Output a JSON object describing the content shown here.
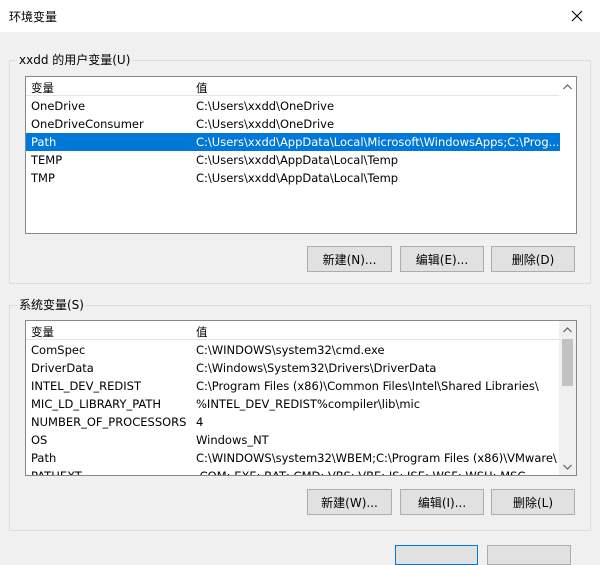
{
  "window": {
    "title": "环境变量"
  },
  "user_vars": {
    "label": "xxdd 的用户变量(U)",
    "columns": [
      "变量",
      "值"
    ],
    "rows": [
      {
        "name": "OneDrive",
        "value": "C:\\Users\\xxdd\\OneDrive"
      },
      {
        "name": "OneDriveConsumer",
        "value": "C:\\Users\\xxdd\\OneDrive"
      },
      {
        "name": "Path",
        "value": "C:\\Users\\xxdd\\AppData\\Local\\Microsoft\\WindowsApps;C:\\Prog..."
      },
      {
        "name": "TEMP",
        "value": "C:\\Users\\xxdd\\AppData\\Local\\Temp"
      },
      {
        "name": "TMP",
        "value": "C:\\Users\\xxdd\\AppData\\Local\\Temp"
      }
    ],
    "selected_row": "Path",
    "buttons": {
      "new": "新建(N)...",
      "edit": "编辑(E)...",
      "delete": "删除(D)"
    }
  },
  "system_vars": {
    "label": "系统变量(S)",
    "columns": [
      "变量",
      "值"
    ],
    "rows": [
      {
        "name": "ComSpec",
        "value": "C:\\WINDOWS\\system32\\cmd.exe"
      },
      {
        "name": "DriverData",
        "value": "C:\\Windows\\System32\\Drivers\\DriverData"
      },
      {
        "name": "INTEL_DEV_REDIST",
        "value": "C:\\Program Files (x86)\\Common Files\\Intel\\Shared Libraries\\"
      },
      {
        "name": "MIC_LD_LIBRARY_PATH",
        "value": "%INTEL_DEV_REDIST%compiler\\lib\\mic"
      },
      {
        "name": "NUMBER_OF_PROCESSORS",
        "value": "4"
      },
      {
        "name": "OS",
        "value": "Windows_NT"
      },
      {
        "name": "Path",
        "value": "C:\\WINDOWS\\system32\\WBEM;C:\\Program Files (x86)\\VMware\\..."
      },
      {
        "name": "PATHEXT",
        "value": ".COM;.EXE;.BAT;.CMD;.VBS;.VBE;.JS;.JSE;.WSF;.WSH;.MSC"
      }
    ],
    "buttons": {
      "new": "新建(W)...",
      "edit": "编辑(I)...",
      "delete": "删除(L)"
    }
  },
  "icons": {
    "close": "close-icon",
    "scroll_up": "chevron-up-icon",
    "scroll_down": "chevron-down-icon"
  }
}
